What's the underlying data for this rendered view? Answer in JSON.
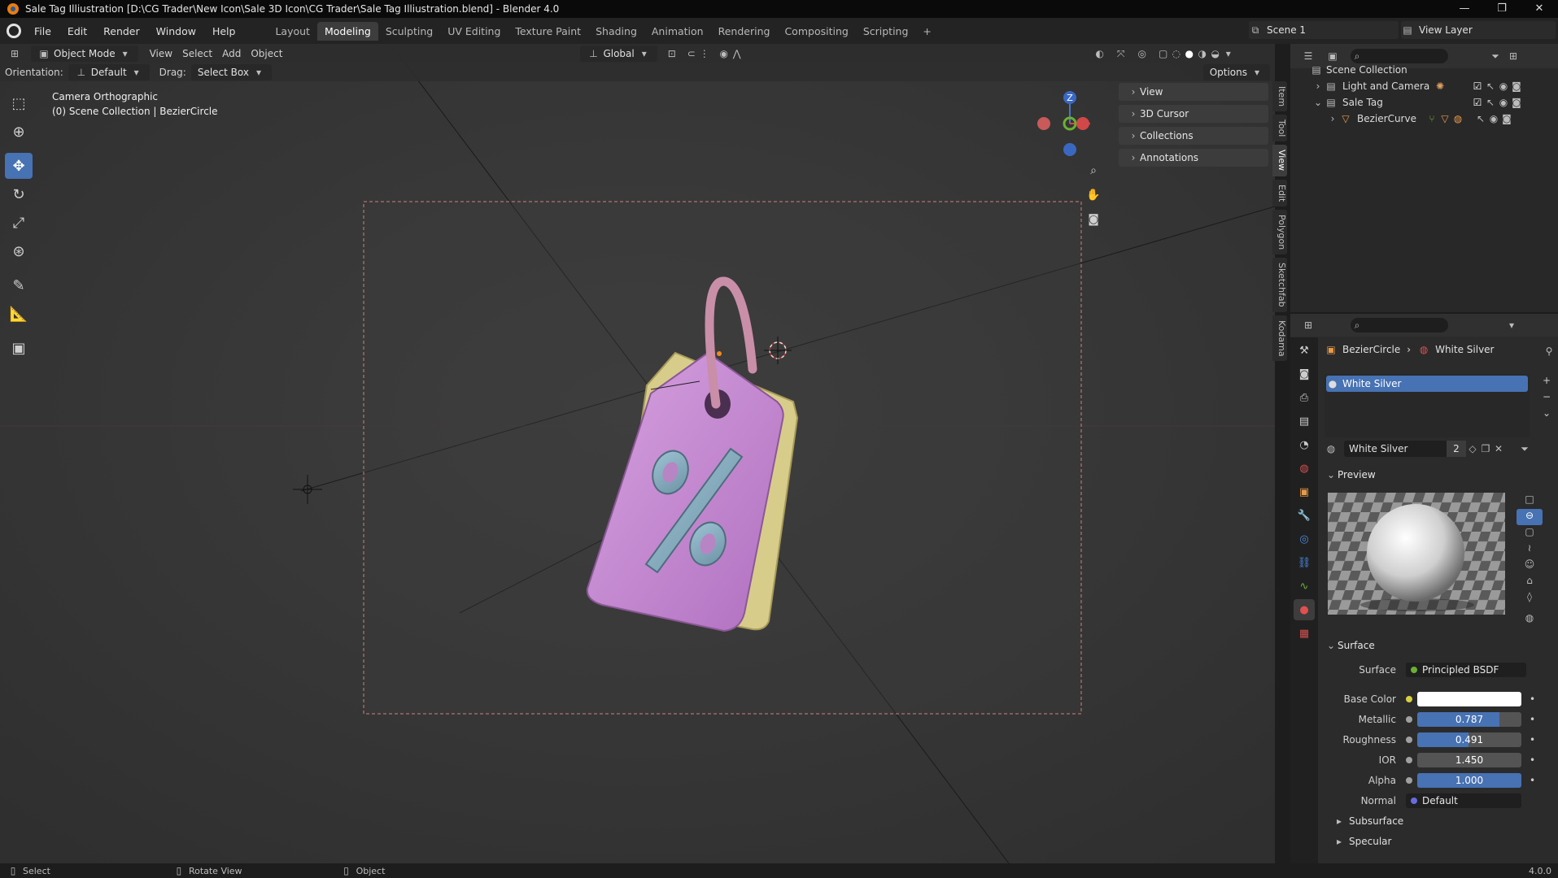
{
  "window": {
    "title": "Sale Tag Illiustration [D:\\CG Trader\\New Icon\\Sale 3D Icon\\CG Trader\\Sale Tag Illiustration.blend] - Blender 4.0",
    "controls": [
      "—",
      "❐",
      "✕"
    ]
  },
  "menubar": {
    "menus": [
      "File",
      "Edit",
      "Render",
      "Window",
      "Help"
    ],
    "workspaces": [
      "Layout",
      "Modeling",
      "Sculpting",
      "UV Editing",
      "Texture Paint",
      "Shading",
      "Animation",
      "Rendering",
      "Compositing",
      "Scripting"
    ],
    "active_workspace": "Modeling",
    "add_tab": "+",
    "scene": "Scene 1",
    "view_layer": "View Layer"
  },
  "viewport_header": {
    "mode": "Object Mode",
    "menus": [
      "View",
      "Select",
      "Add",
      "Object"
    ],
    "transform_orientation": "Global"
  },
  "tool_header": {
    "orientation_label": "Orientation:",
    "orientation_value": "Default",
    "drag_label": "Drag:",
    "drag_value": "Select Box",
    "options": "Options"
  },
  "viewport": {
    "camera_label": "Camera Orthographic",
    "context_label": "(0) Scene Collection | BezierCircle",
    "gizmo": {
      "z": "Z",
      "x": "X"
    }
  },
  "npanel": {
    "items": [
      "View",
      "3D Cursor",
      "Collections",
      "Annotations"
    ],
    "tabs": [
      "Item",
      "Tool",
      "View",
      "Edit",
      "Polygon",
      "Sketchfab",
      "Kodama"
    ],
    "active_tab": "View"
  },
  "outliner": {
    "root": "Scene Collection",
    "rows": [
      {
        "label": "Light and Camera",
        "indent": 1
      },
      {
        "label": "Sale Tag",
        "indent": 1
      },
      {
        "label": "BezierCurve",
        "indent": 2
      }
    ]
  },
  "properties": {
    "breadcrumb_object": "BezierCircle",
    "breadcrumb_material": "White Silver",
    "slot": "White Silver",
    "material_name": "White Silver",
    "users": "2",
    "preview_label": "Preview",
    "surface_section": "Surface",
    "fields": {
      "surface": {
        "label": "Surface",
        "value": "Principled BSDF"
      },
      "base_color": {
        "label": "Base Color",
        "color": "#ffffff"
      },
      "metallic": {
        "label": "Metallic",
        "value": "0.787",
        "fraction": 0.787
      },
      "roughness": {
        "label": "Roughness",
        "value": "0.491",
        "fraction": 0.491
      },
      "ior": {
        "label": "IOR",
        "value": "1.450",
        "fraction": 0
      },
      "alpha": {
        "label": "Alpha",
        "value": "1.000",
        "fraction": 1.0
      },
      "normal": {
        "label": "Normal",
        "value": "Default"
      }
    },
    "subsections": [
      "Subsurface",
      "Specular"
    ]
  },
  "statusbar": {
    "items": [
      "Select",
      "Rotate View",
      "Object"
    ],
    "version": "4.0.0"
  },
  "colors": {
    "accent": "#4772b3",
    "tag_front": "#c48bd0",
    "tag_back": "#d8cc8a",
    "percent": "#7fa6b8",
    "ring": "#c98ea8"
  }
}
